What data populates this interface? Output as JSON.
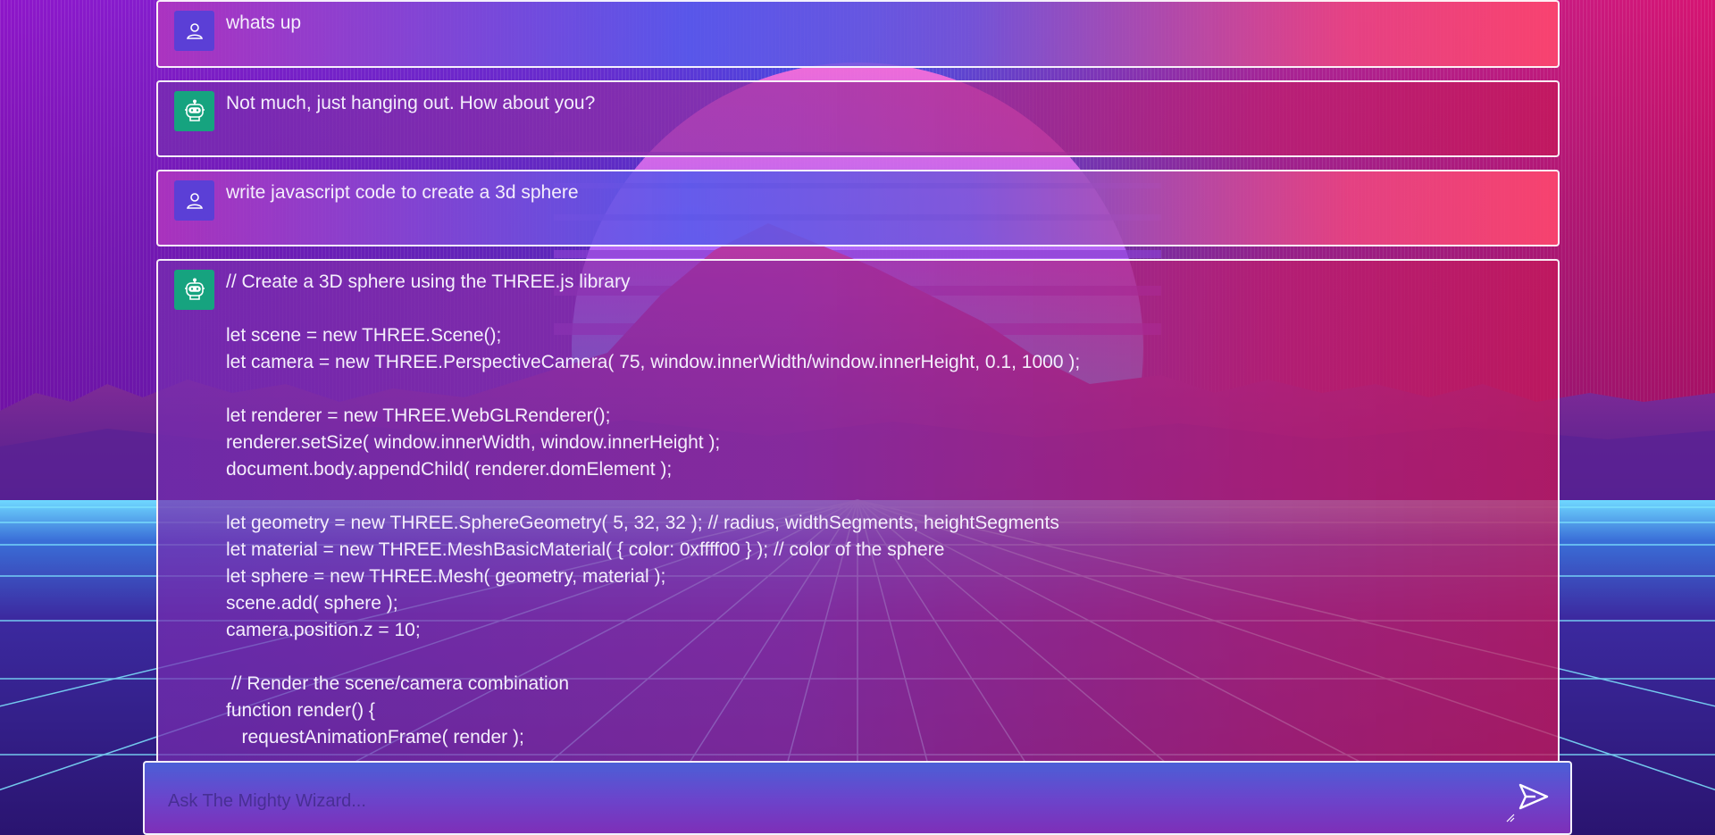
{
  "messages": [
    {
      "role": "user",
      "avatar_icon": "user-icon",
      "text": "whats up"
    },
    {
      "role": "bot",
      "avatar_icon": "robot-icon",
      "text": "Not much, just hanging out. How about you?"
    },
    {
      "role": "user",
      "avatar_icon": "user-icon",
      "text": "write javascript code to create a 3d sphere"
    },
    {
      "role": "bot",
      "avatar_icon": "robot-icon",
      "text": "// Create a 3D sphere using the THREE.js library\n\nlet scene = new THREE.Scene();\nlet camera = new THREE.PerspectiveCamera( 75, window.innerWidth/window.innerHeight, 0.1, 1000 );\n\nlet renderer = new THREE.WebGLRenderer();\nrenderer.setSize( window.innerWidth, window.innerHeight );\ndocument.body.appendChild( renderer.domElement );\n\nlet geometry = new THREE.SphereGeometry( 5, 32, 32 ); // radius, widthSegments, heightSegments\nlet material = new THREE.MeshBasicMaterial( { color: 0xffff00 } ); // color of the sphere\nlet sphere = new THREE.Mesh( geometry, material );\nscene.add( sphere );\ncamera.position.z = 10;\n\n // Render the scene/camera combination\nfunction render() {\n   requestAnimationFrame( render );"
    }
  ],
  "composer": {
    "placeholder": "Ask The Mighty Wizard...",
    "send_icon": "send-icon"
  },
  "colors": {
    "user_avatar": "#5b3fd6",
    "bot_avatar": "#16a37f",
    "sky_top": "#7b1fc9",
    "sun": "#2cc8ff",
    "grid_line": "#7fe6ff"
  }
}
